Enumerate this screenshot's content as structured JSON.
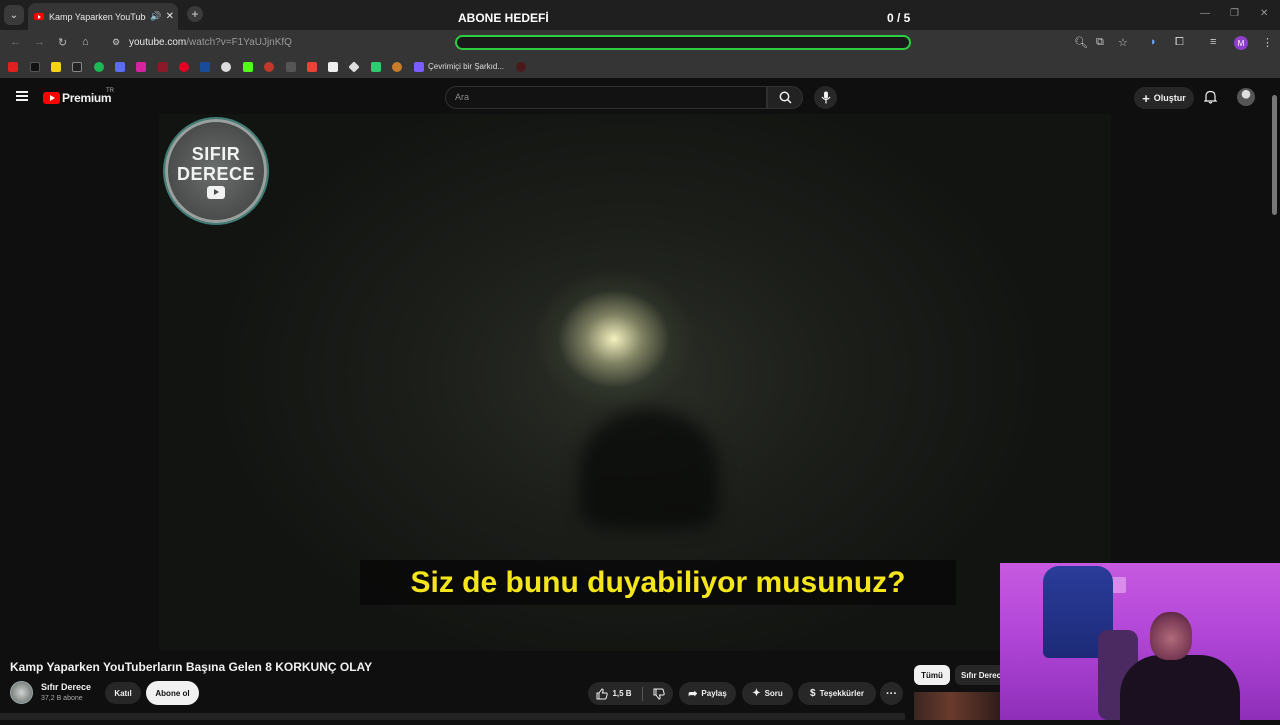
{
  "browser": {
    "tab_title": "Kamp Yaparken YouTuberla",
    "tab_speaker_icon": "speaker-icon",
    "url_host": "youtube.com",
    "url_rest": "/watch?v=F1YaUJjnKfQ",
    "bookmark_label": "Çevrimiçi bir Şarkıd..."
  },
  "overlay": {
    "goal_label": "ABONE HEDEFİ",
    "goal_count": "0 / 5",
    "goal_progress": 0
  },
  "youtube": {
    "logo_text": "Premium",
    "logo_region": "TR",
    "search_placeholder": "Ara",
    "create_label": "Oluştur"
  },
  "video": {
    "watermark_line1": "SIFIR",
    "watermark_line2": "DERECE",
    "subtitle": "Siz de bunu duyabiliyor musunuz?"
  },
  "watch": {
    "title": "Kamp Yaparken YouTuberların Başına Gelen 8 KORKUNÇ OLAY",
    "channel_name": "Sıfır Derece",
    "channel_subs": "37,2 B abone",
    "join_label": "Katıl",
    "subscribe_label": "Abone ol",
    "like_count": "1,5 B",
    "share_label": "Paylaş",
    "ask_label": "Soru",
    "thanks_label": "Teşekkürler"
  },
  "sidebar_chips": {
    "all_label": "Tümü",
    "channel_label": "Sıfır Derece"
  },
  "colors": {
    "goal_bar": "#2ecc40",
    "subtitle_text": "#f5e61c",
    "yt_red": "#ff0000",
    "webcam_tint": "#b246d8"
  }
}
